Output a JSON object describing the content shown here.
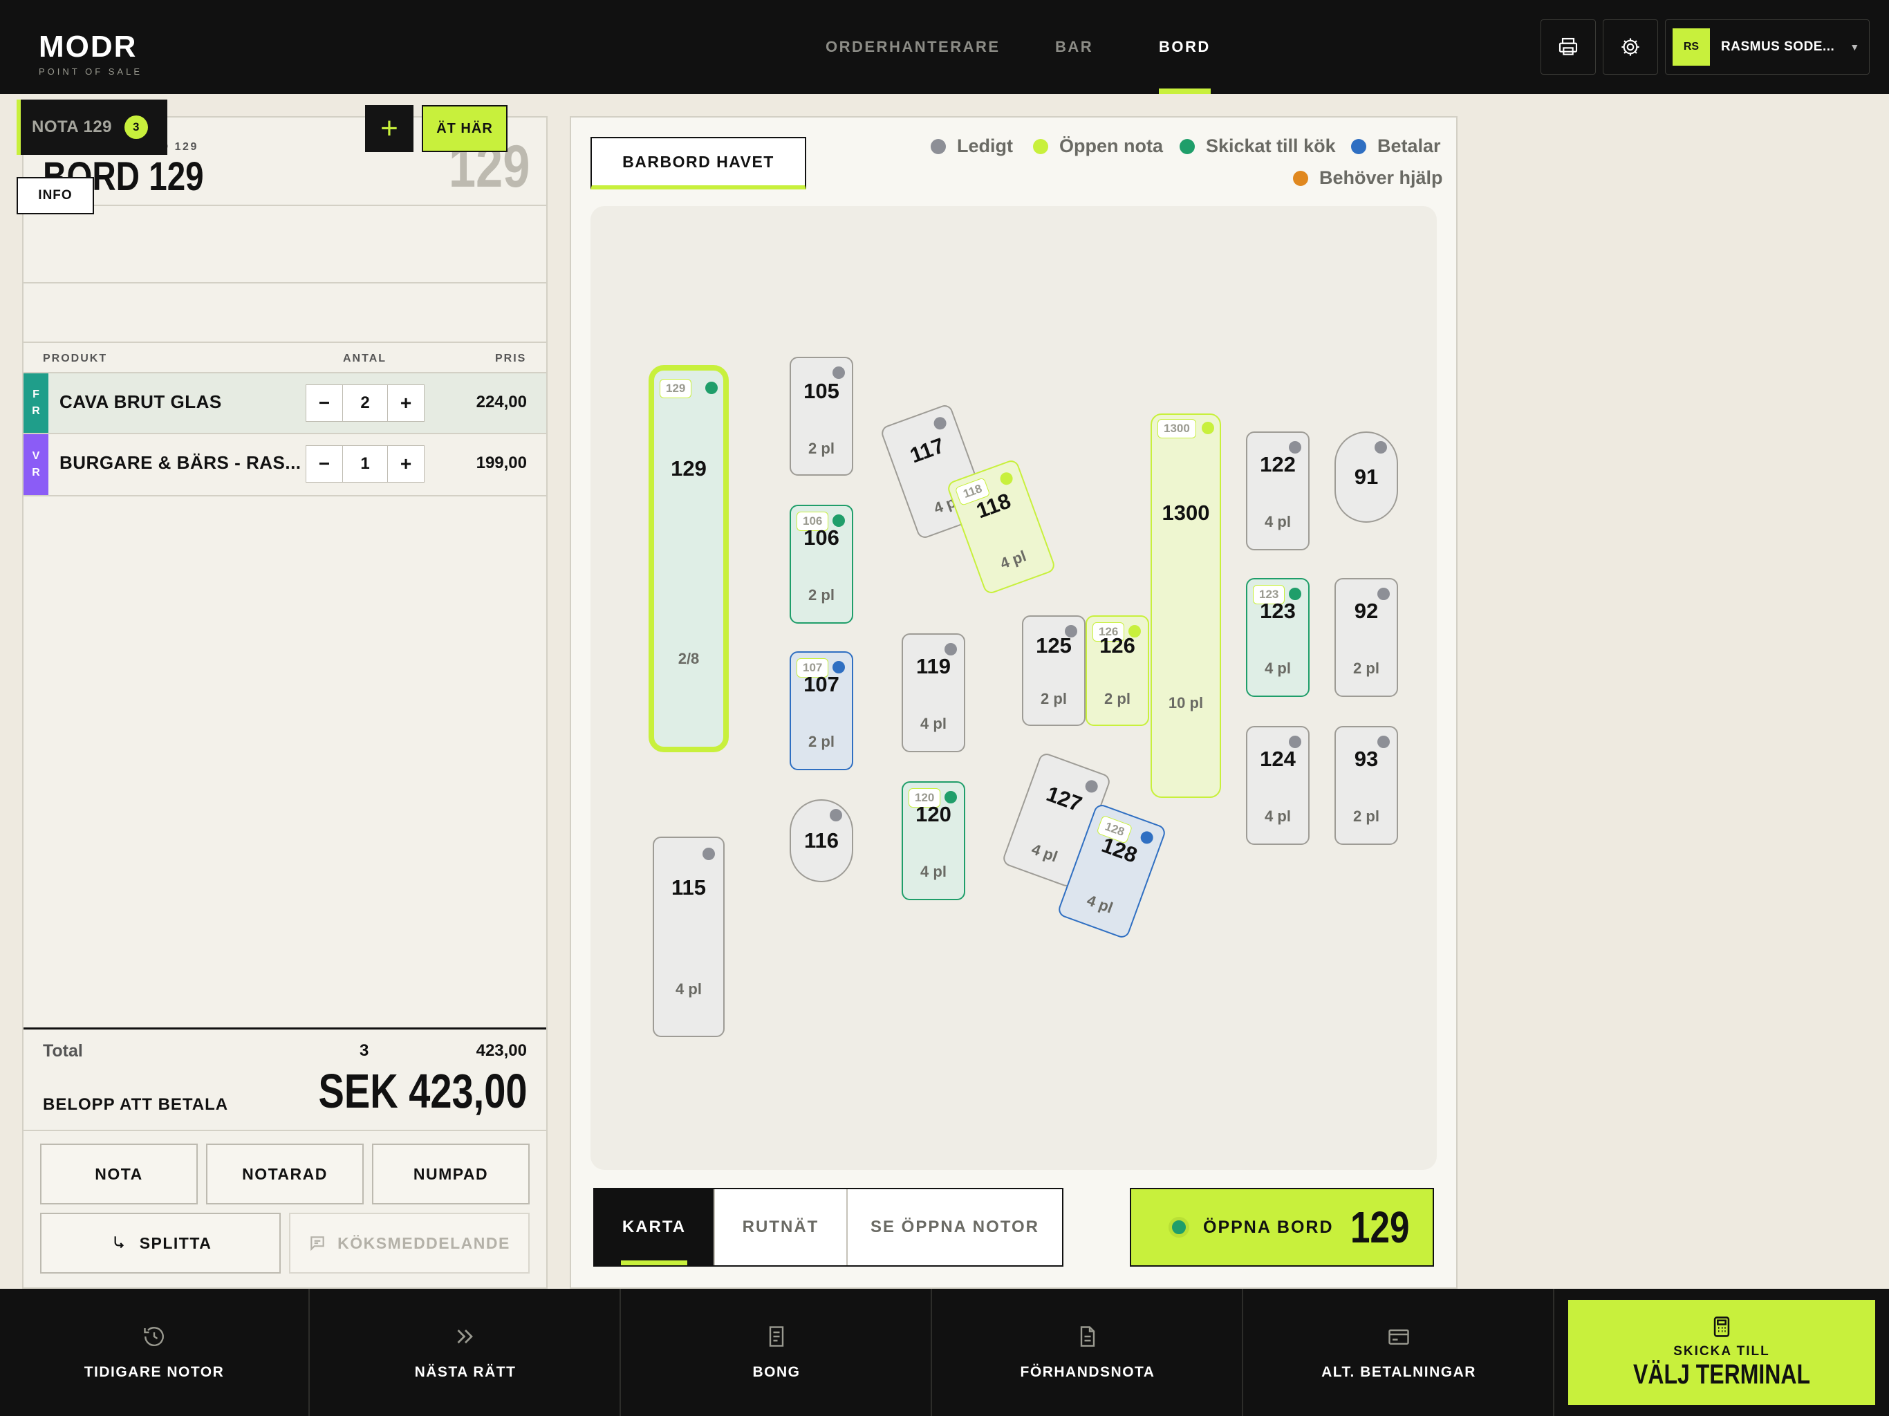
{
  "brand": {
    "name": "MODR",
    "tagline": "POINT OF SALE"
  },
  "nav": [
    {
      "label": "ORDERHANTERARE",
      "active": false
    },
    {
      "label": "BAR",
      "active": false
    },
    {
      "label": "BORD",
      "active": true
    }
  ],
  "user": {
    "initials": "RS",
    "name": "RASMUS SODE..."
  },
  "left": {
    "subtitle": "AKTIV YTA · BORD 129",
    "title": "BORD 129",
    "table_number": "129",
    "nota_label": "NOTA 129",
    "nota_count": "3",
    "add_icon": "+",
    "eat_here": "ÄT HÄR",
    "info": "INFO",
    "col_product": "PRODUKT",
    "col_qty": "ANTAL",
    "col_price": "PRIS",
    "items": [
      {
        "cat1": "F",
        "cat2": "R",
        "cat_color": "#1f9e8a",
        "name": "CAVA BRUT GLAS",
        "qty": "2",
        "price": "224,00"
      },
      {
        "cat1": "V",
        "cat2": "R",
        "cat_color": "#8b5cf6",
        "name": "BURGARE & BÄRS - RAS...",
        "qty": "1",
        "price": "199,00"
      }
    ],
    "total_label": "Total",
    "total_count": "3",
    "total_sum": "423,00",
    "balance_label": "BELOPP ATT BETALA",
    "balance_amount": "SEK 423,00",
    "buttons": {
      "nota": "NOTA",
      "notarad": "NOTARAD",
      "numpad": "NUMPAD",
      "split": "SPLITTA",
      "kitchen": "KÖKSMEDDELANDE"
    }
  },
  "map": {
    "area_tab": "BARBORD HAVET",
    "legend": [
      {
        "label": "Ledigt",
        "color": "#8d8f96"
      },
      {
        "label": "Öppen nota",
        "color": "#c8f03c"
      },
      {
        "label": "Skickat till kök",
        "color": "#1f9e6a"
      },
      {
        "label": "Betalar",
        "color": "#2f6fc2"
      },
      {
        "label": "Behöver hjälp",
        "color": "#e0881f"
      }
    ],
    "tables": [
      {
        "num": "129",
        "seats": "2/8",
        "status": "open_selected",
        "tag": "129"
      },
      {
        "num": "105",
        "seats": "2 pl",
        "status": "free"
      },
      {
        "num": "106",
        "seats": "2 pl",
        "status": "kitchen",
        "tag": "106"
      },
      {
        "num": "107",
        "seats": "2 pl",
        "status": "paying",
        "tag": "107"
      },
      {
        "num": "116",
        "seats": "",
        "status": "free"
      },
      {
        "num": "115",
        "seats": "4 pl",
        "status": "free"
      },
      {
        "num": "117",
        "seats": "4 pl",
        "status": "free"
      },
      {
        "num": "118",
        "seats": "4 pl",
        "status": "open",
        "tag": "118"
      },
      {
        "num": "119",
        "seats": "4 pl",
        "status": "free"
      },
      {
        "num": "120",
        "seats": "4 pl",
        "status": "kitchen",
        "tag": "120"
      },
      {
        "num": "125",
        "seats": "2 pl",
        "status": "free"
      },
      {
        "num": "126",
        "seats": "2 pl",
        "status": "open",
        "tag": "126"
      },
      {
        "num": "127",
        "seats": "4 pl",
        "status": "free"
      },
      {
        "num": "128",
        "seats": "4 pl",
        "status": "paying",
        "tag": "128"
      },
      {
        "num": "1300",
        "seats": "10 pl",
        "status": "open",
        "tag": "1300"
      },
      {
        "num": "122",
        "seats": "4 pl",
        "status": "free"
      },
      {
        "num": "123",
        "seats": "4 pl",
        "status": "kitchen",
        "tag": "123"
      },
      {
        "num": "124",
        "seats": "4 pl",
        "status": "free"
      },
      {
        "num": "91",
        "seats": "",
        "status": "free"
      },
      {
        "num": "92",
        "seats": "2 pl",
        "status": "free"
      },
      {
        "num": "93",
        "seats": "2 pl",
        "status": "free"
      }
    ],
    "view_tabs": [
      {
        "label": "KARTA",
        "active": true
      },
      {
        "label": "RUTNÄT",
        "active": false
      },
      {
        "label": "SE ÖPPNA NOTOR",
        "active": false
      }
    ],
    "open_table_label": "ÖPPNA BORD",
    "open_table_num": "129"
  },
  "bottom": {
    "items": [
      {
        "label": "TIDIGARE NOTOR",
        "icon": "history-icon"
      },
      {
        "label": "NÄSTA RÄTT",
        "icon": "double-chevron-icon"
      },
      {
        "label": "BONG",
        "icon": "receipt-icon"
      },
      {
        "label": "FÖRHANDSNOTA",
        "icon": "document-icon"
      },
      {
        "label": "ALT. BETALNINGAR",
        "icon": "card-icon"
      }
    ],
    "send_sub": "SKICKA TILL",
    "send_main": "VÄLJ TERMINAL"
  }
}
